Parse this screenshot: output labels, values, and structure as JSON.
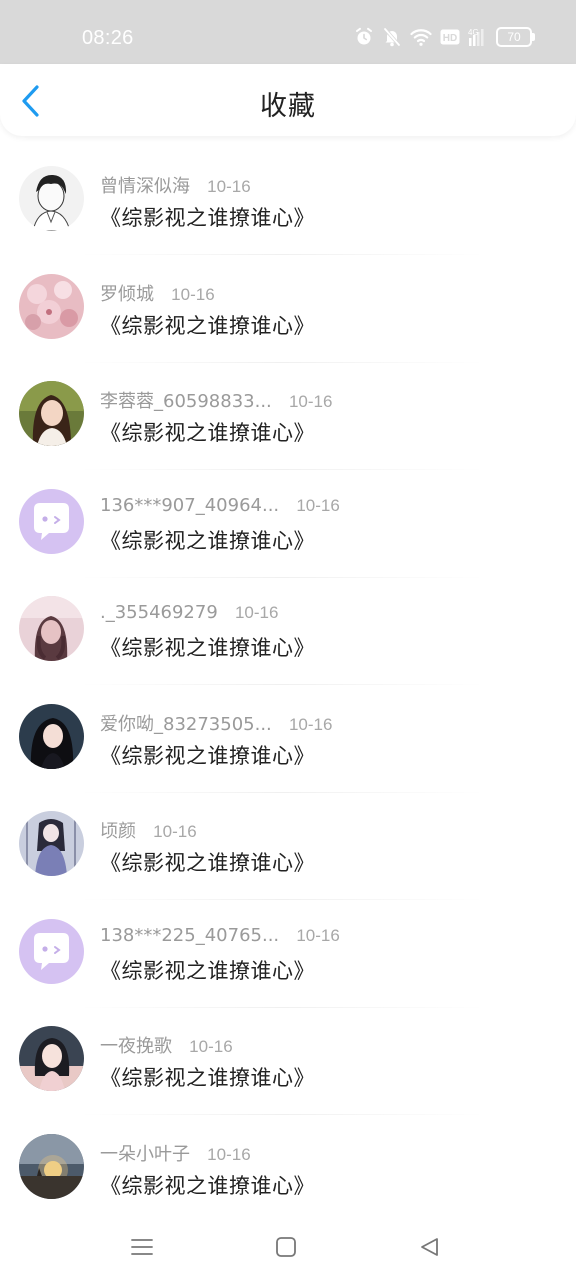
{
  "status_bar": {
    "time": "08:26",
    "icons": [
      "alarm-icon",
      "mute-icon",
      "wifi-icon",
      "hd-icon",
      "signal-4g-icon"
    ],
    "battery": "70"
  },
  "header": {
    "back_icon": "chevron-left-icon",
    "title": "收藏",
    "accent_color": "#1e9bf0"
  },
  "items": [
    {
      "name": "曾情深似海",
      "date": "10-16",
      "title": "《综影视之谁撩谁心》",
      "avatar": "anime-boy"
    },
    {
      "name": "罗倾城",
      "date": "10-16",
      "title": "《综影视之谁撩谁心》",
      "avatar": "pink-flowers"
    },
    {
      "name": "李蓉蓉_60598833...",
      "date": "10-16",
      "title": "《综影视之谁撩谁心》",
      "avatar": "woman-photo"
    },
    {
      "name": "136***907_40964...",
      "date": "10-16",
      "title": "《综影视之谁撩谁心》",
      "avatar": "default-chat"
    },
    {
      "name": "._355469279",
      "date": "10-16",
      "title": "《综影视之谁撩谁心》",
      "avatar": "pink-girl"
    },
    {
      "name": "爱你呦_83273505...",
      "date": "10-16",
      "title": "《综影视之谁撩谁心》",
      "avatar": "dark-woman"
    },
    {
      "name": "顷颜",
      "date": "10-16",
      "title": "《综影视之谁撩谁心》",
      "avatar": "anime-girl"
    },
    {
      "name": "138***225_40765...",
      "date": "10-16",
      "title": "《综影视之谁撩谁心》",
      "avatar": "default-chat"
    },
    {
      "name": "一夜挽歌",
      "date": "10-16",
      "title": "《综影视之谁撩谁心》",
      "avatar": "girl-pink"
    },
    {
      "name": "一朵小叶子",
      "date": "10-16",
      "title": "《综影视之谁撩谁心》",
      "avatar": "sunset"
    }
  ],
  "bottom_nav": [
    "menu-icon",
    "home-icon",
    "back-triangle-icon"
  ]
}
